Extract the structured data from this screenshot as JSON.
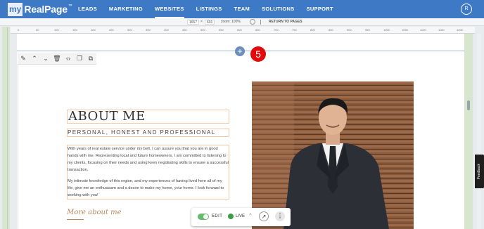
{
  "brand": {
    "my": "my",
    "name": "RealPage",
    "tm": "™"
  },
  "nav": {
    "items": [
      {
        "label": "LEADS"
      },
      {
        "label": "MARKETING"
      },
      {
        "label": "WEBSITES",
        "active": true
      },
      {
        "label": "LISTINGS"
      },
      {
        "label": "TEAM"
      },
      {
        "label": "SOLUTIONS"
      },
      {
        "label": "SUPPORT"
      }
    ],
    "avatar": "R"
  },
  "toolbar": {
    "width": "1657",
    "height": "691",
    "x_label": "×",
    "zoom": "zoom: 100%",
    "return_label": "RETURN TO PAGES"
  },
  "ruler": {
    "ticks": [
      "0",
      "50",
      "100",
      "150",
      "200",
      "250",
      "300",
      "350",
      "400",
      "450",
      "500",
      "550",
      "600",
      "650",
      "700",
      "750",
      "800",
      "850",
      "900",
      "950",
      "1000",
      "1050",
      "1100",
      "1150",
      "1200"
    ]
  },
  "canvas": {
    "add_icon": "+",
    "step_badge": "5"
  },
  "about": {
    "title": "ABOUT ME",
    "subtitle": "PERSONAL, HONEST AND PROFESSIONAL",
    "paragraph_1": "With years of real estate service under my belt, I can assure you that you are in good hands with me. Representing local and future homeowners, I am committed to listening to my clients, focusing on their needs and using keen negotiating skills to ensure a successful transaction.",
    "paragraph_2": "My intimate knowledge of this region, and my experiences of having lived here all of my life, give me an enthusiasm and a desire to make my home, your home. I look forward to working with you!",
    "more_link": "More about me"
  },
  "controls": {
    "edit_label": "EDIT",
    "live_label": "LIVE"
  },
  "feedback": "Feedback",
  "colors": {
    "nav_bg": "#3e79c5",
    "badge": "#e00c0c",
    "toggle_on": "#66bb6a",
    "accent": "#b58b5f"
  }
}
